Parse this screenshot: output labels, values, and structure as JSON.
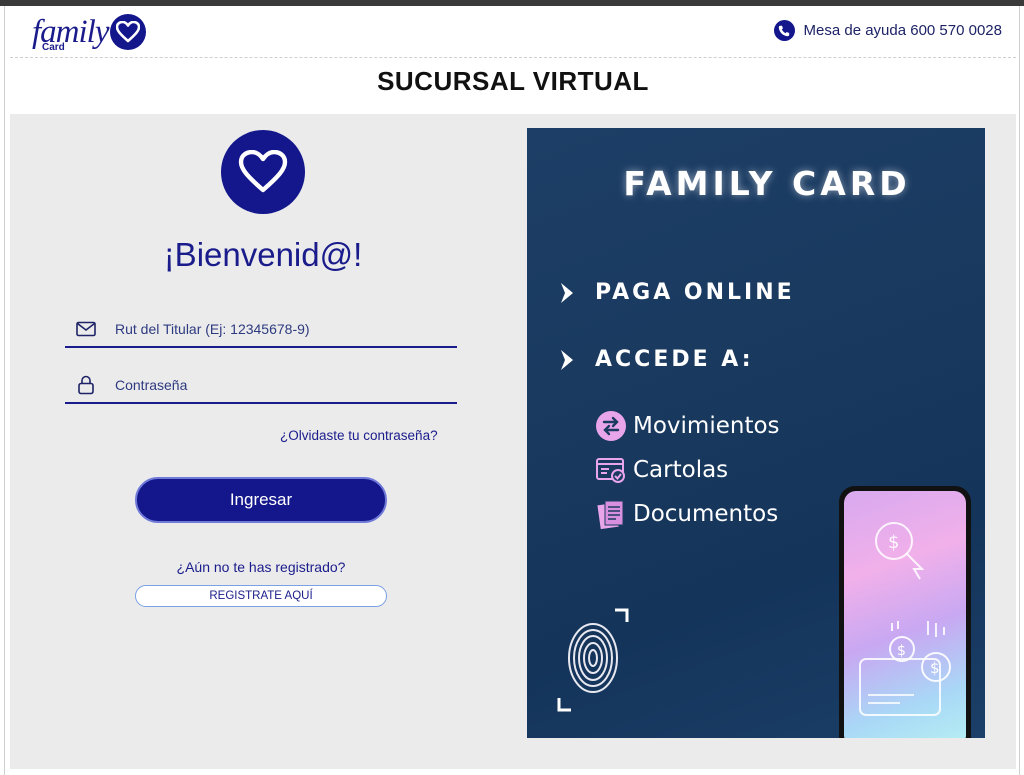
{
  "header": {
    "logo_text": "family",
    "logo_sub": "Card",
    "helpdesk_label": "Mesa de ayuda 600 570 0028"
  },
  "page_title": "SUCURSAL VIRTUAL",
  "login": {
    "welcome": "¡Bienvenid@!",
    "rut_placeholder": "Rut del Titular (Ej: 12345678-9)",
    "rut_value": "",
    "password_placeholder": "Contraseña",
    "password_value": "",
    "forgot_link": "¿Olvidaste tu contraseña?",
    "login_button": "Ingresar",
    "not_registered": "¿Aún no te has registrado?",
    "register_button": "REGISTRATE AQUÍ"
  },
  "promo": {
    "title": "FAMILY CARD",
    "line1": "PAGA ONLINE",
    "line2": "ACCEDE A:",
    "items": [
      {
        "label": "Movimientos",
        "icon": "transfer-icon"
      },
      {
        "label": "Cartolas",
        "icon": "statement-icon"
      },
      {
        "label": "Documentos",
        "icon": "documents-icon"
      }
    ]
  },
  "colors": {
    "brand_blue": "#14168c",
    "panel_gray": "#ebebeb",
    "promo_navy": "#1a3a60"
  }
}
